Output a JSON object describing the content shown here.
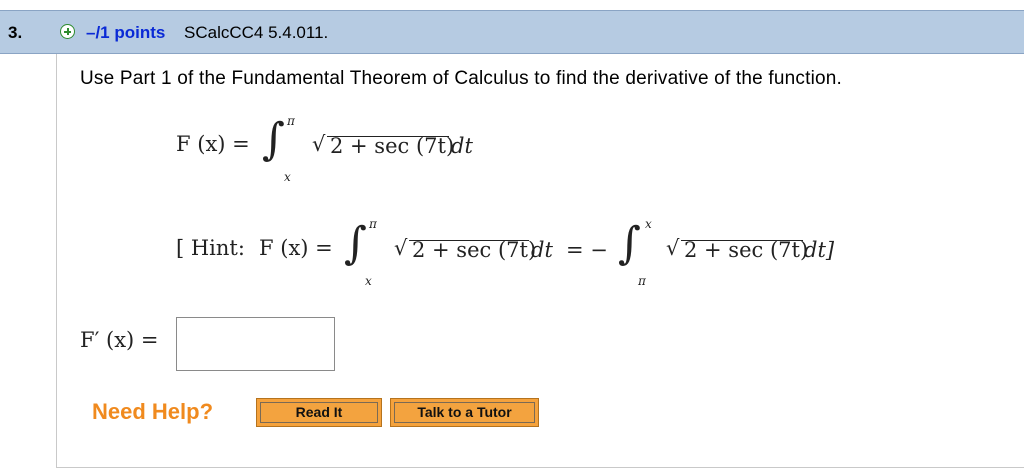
{
  "question": {
    "number": "3.",
    "expand_icon": "plus-circle-icon",
    "points": "–/1 points",
    "code": "SCalcCC4 5.4.011."
  },
  "instruction": "Use Part 1 of the Fundamental Theorem of Calculus to find the derivative of the function.",
  "function_equation": {
    "lhs": "F (x) =",
    "upper_limit": "π",
    "lower_limit": "x",
    "integrand": "2 + sec (7t)",
    "differential": "dt"
  },
  "hint": {
    "open": "[ Hint:",
    "lhs": "F (x) =",
    "upper_limit_1": "π",
    "lower_limit_1": "x",
    "integrand_1": "2 + sec (7t)",
    "differential_1": "dt",
    "equals_minus": "= −",
    "upper_limit_2": "x",
    "lower_limit_2": "π",
    "integrand_2": "2 + sec (7t)",
    "differential_2": "dt]"
  },
  "answer": {
    "label": "F′ (x) =",
    "value": ""
  },
  "help": {
    "label": "Need Help?",
    "read_it": "Read It",
    "talk_to_tutor": "Talk to a Tutor"
  }
}
